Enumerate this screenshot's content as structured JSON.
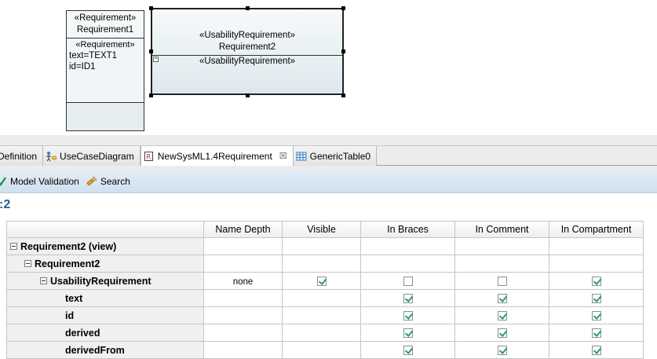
{
  "diagram": {
    "req1": {
      "stereotype": "«Requirement»",
      "name": "Requirement1",
      "compartment_stereotype": "«Requirement»",
      "text_attr": "text=TEXT1",
      "id_attr": "id=ID1"
    },
    "req2": {
      "stereotype": "«UsabilityRequirement»",
      "name": "Requirement2",
      "compartment_stereotype": "«UsabilityRequirement»"
    }
  },
  "tabs": [
    {
      "label": "Definition"
    },
    {
      "label": "UseCaseDiagram"
    },
    {
      "label": "NewSysML1.4Requirement",
      "close": "☒"
    },
    {
      "label": "GenericTable0"
    }
  ],
  "toolbar": {
    "validation_label": "Model Validation",
    "search_label": "Search"
  },
  "page_title": ":2",
  "table": {
    "headers": [
      "",
      "Name Depth",
      "Visible",
      "In Braces",
      "In Comment",
      "In Compartment"
    ],
    "rows": [
      {
        "label": "Requirement2 (view)",
        "level": 0,
        "expander": true,
        "name_depth": "",
        "visible": null,
        "in_braces": null,
        "in_comment": null,
        "in_compartment": null
      },
      {
        "label": "Requirement2",
        "level": 1,
        "expander": true,
        "name_depth": "",
        "visible": null,
        "in_braces": null,
        "in_comment": null,
        "in_compartment": null
      },
      {
        "label": "UsabilityRequirement",
        "level": 2,
        "expander": true,
        "name_depth": "none",
        "visible": true,
        "in_braces": false,
        "in_comment": false,
        "in_compartment": true
      },
      {
        "label": "text",
        "level": 3,
        "expander": false,
        "name_depth": "",
        "visible": null,
        "in_braces": true,
        "in_comment": true,
        "in_compartment": true
      },
      {
        "label": "id",
        "level": 3,
        "expander": false,
        "name_depth": "",
        "visible": null,
        "in_braces": true,
        "in_comment": true,
        "in_compartment": true
      },
      {
        "label": "derived",
        "level": 3,
        "expander": false,
        "name_depth": "",
        "visible": null,
        "in_braces": true,
        "in_comment": true,
        "in_compartment": true
      },
      {
        "label": "derivedFrom",
        "level": 3,
        "expander": false,
        "name_depth": "",
        "visible": null,
        "in_braces": true,
        "in_comment": true,
        "in_compartment": true
      }
    ]
  }
}
